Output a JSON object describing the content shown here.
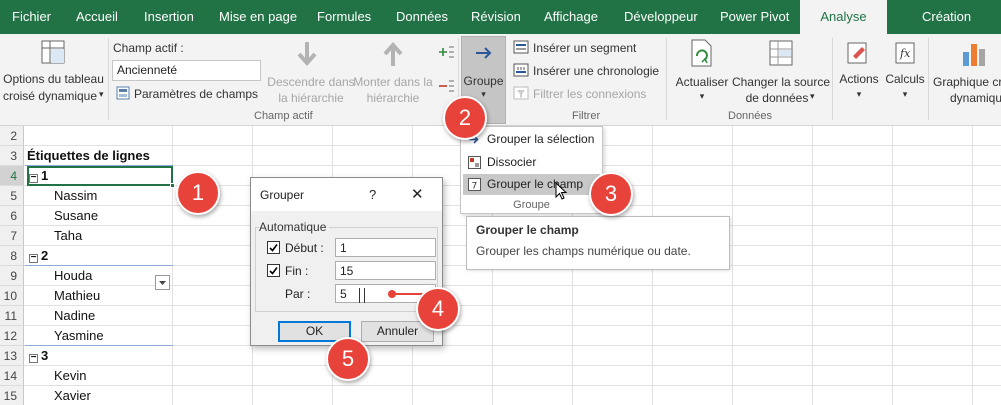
{
  "tabs": [
    {
      "label": "Fichier",
      "active": false
    },
    {
      "label": "Accueil",
      "active": false
    },
    {
      "label": "Insertion",
      "active": false
    },
    {
      "label": "Mise en page",
      "active": false
    },
    {
      "label": "Formules",
      "active": false
    },
    {
      "label": "Données",
      "active": false
    },
    {
      "label": "Révision",
      "active": false
    },
    {
      "label": "Affichage",
      "active": false
    },
    {
      "label": "Développeur",
      "active": false
    },
    {
      "label": "Power Pivot",
      "active": false
    },
    {
      "label": "Analyse",
      "active": true
    },
    {
      "label": "Création",
      "active": false
    }
  ],
  "ribbon": {
    "options": {
      "line1": "Options du tableau",
      "line2": "croisé dynamique",
      "arrow": "▾"
    },
    "active_field": {
      "label": "Champ actif :",
      "value": "Ancienneté",
      "params": "Paramètres de champs",
      "drill_down_1": "Descendre dans",
      "drill_down_2": "la hiérarchie",
      "drill_up_1": "Monter dans la",
      "drill_up_2": "hiérarchie",
      "group_label": "Champ actif"
    },
    "group_btn": {
      "label": "Groupe",
      "arrow": "▾"
    },
    "filter": {
      "slicer": "Insérer un segment",
      "timeline": "Insérer une chronologie",
      "connections": "Filtrer les connexions",
      "group_label": "Filtrer"
    },
    "data": {
      "refresh": "Actualiser",
      "change_source_1": "Changer la source",
      "change_source_2": "de données",
      "group_label": "Données"
    },
    "actions": "Actions",
    "calcs": "Calculs",
    "chart_1": "Graphique cr",
    "chart_2": "dynamiqu"
  },
  "grid": {
    "rows": [
      {
        "num": "2",
        "text": "",
        "kind": "empty"
      },
      {
        "num": "3",
        "text": "Étiquettes de lignes",
        "kind": "header"
      },
      {
        "num": "4",
        "text": "1",
        "kind": "group"
      },
      {
        "num": "5",
        "text": "Nassim",
        "kind": "item"
      },
      {
        "num": "6",
        "text": "Susane",
        "kind": "item"
      },
      {
        "num": "7",
        "text": "Taha",
        "kind": "item"
      },
      {
        "num": "8",
        "text": "2",
        "kind": "group"
      },
      {
        "num": "9",
        "text": "Houda",
        "kind": "item"
      },
      {
        "num": "10",
        "text": "Mathieu",
        "kind": "item"
      },
      {
        "num": "11",
        "text": "Nadine",
        "kind": "item"
      },
      {
        "num": "12",
        "text": "Yasmine",
        "kind": "item"
      },
      {
        "num": "13",
        "text": "3",
        "kind": "group"
      },
      {
        "num": "14",
        "text": "Kevin",
        "kind": "item"
      },
      {
        "num": "15",
        "text": "Xavier",
        "kind": "item"
      }
    ]
  },
  "menu": {
    "items": [
      "Grouper la sélection",
      "Dissocier",
      "Grouper le champ"
    ],
    "footer": "Groupe"
  },
  "tooltip": {
    "title": "Grouper le champ",
    "body": "Grouper les champs numérique ou date."
  },
  "dialog": {
    "title": "Grouper",
    "help": "?",
    "close": "✕",
    "section": "Automatique",
    "start_label": "Début :",
    "start_value": "1",
    "end_label": "Fin :",
    "end_value": "15",
    "by_label": "Par :",
    "by_value": "5",
    "ok": "OK",
    "cancel": "Annuler"
  },
  "callouts": [
    "1",
    "2",
    "3",
    "4",
    "5"
  ],
  "colors": {
    "excel_green": "#217346",
    "callout_red": "#e8433a",
    "focus_blue": "#0078d7"
  }
}
